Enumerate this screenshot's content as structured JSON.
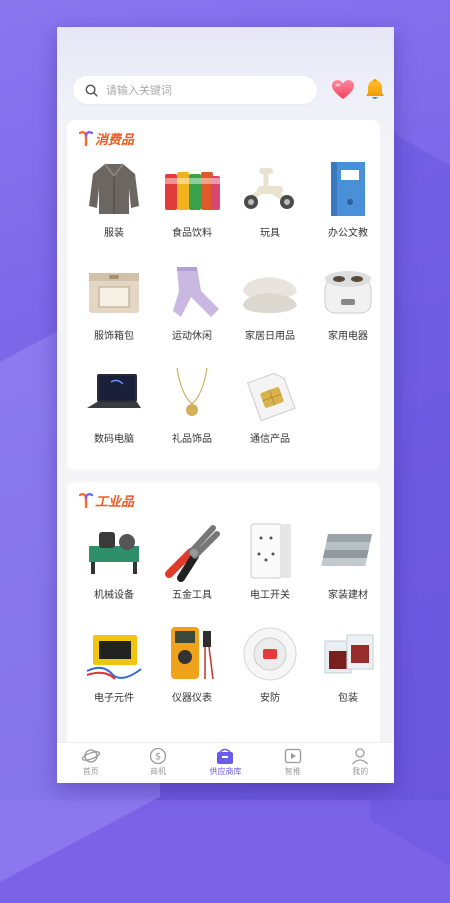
{
  "search": {
    "placeholder": "请输入关键词"
  },
  "header_icons": {
    "favorite": "heart-icon",
    "notifications": "bell-icon"
  },
  "sections": {
    "consumer": {
      "title": "消费品",
      "items": [
        {
          "label": "服装",
          "icon": "clothing-image"
        },
        {
          "label": "食品饮料",
          "icon": "food-drink-image"
        },
        {
          "label": "玩具",
          "icon": "toy-image"
        },
        {
          "label": "办公文教",
          "icon": "office-supplies-image"
        },
        {
          "label": "服饰箱包",
          "icon": "storage-box-image"
        },
        {
          "label": "运动休闲",
          "icon": "sportswear-image"
        },
        {
          "label": "家居日用品",
          "icon": "pillow-image"
        },
        {
          "label": "家用电器",
          "icon": "rice-cooker-image"
        },
        {
          "label": "数码电脑",
          "icon": "laptop-image"
        },
        {
          "label": "礼品饰品",
          "icon": "necklace-image"
        },
        {
          "label": "通信产品",
          "icon": "sim-card-image"
        }
      ]
    },
    "industrial": {
      "title": "工业品",
      "items": [
        {
          "label": "机械设备",
          "icon": "machinery-image"
        },
        {
          "label": "五金工具",
          "icon": "pliers-image"
        },
        {
          "label": "电工开关",
          "icon": "wall-switch-image"
        },
        {
          "label": "家装建材",
          "icon": "tiles-image"
        },
        {
          "label": "电子元件",
          "icon": "electronic-module-image"
        },
        {
          "label": "仪器仪表",
          "icon": "multimeter-image"
        },
        {
          "label": "安防",
          "icon": "smoke-detector-image"
        },
        {
          "label": "包装",
          "icon": "packaging-bags-image"
        }
      ]
    }
  },
  "tabbar": [
    {
      "label": "首页",
      "icon": "planet-icon",
      "active": false
    },
    {
      "label": "商机",
      "icon": "dollar-icon",
      "active": false
    },
    {
      "label": "供应商库",
      "icon": "store-icon",
      "active": true
    },
    {
      "label": "智推",
      "icon": "video-icon",
      "active": false
    },
    {
      "label": "我的",
      "icon": "user-icon",
      "active": false
    }
  ],
  "colors": {
    "accent": "#6b5ce7",
    "section_title": "#f15a24",
    "background": "#7b63e8"
  }
}
